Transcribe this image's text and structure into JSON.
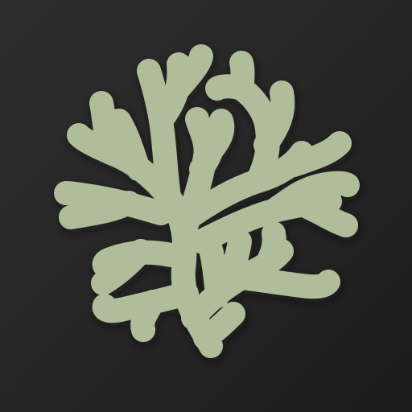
{
  "app_icon": {
    "background_color": "#262626",
    "emblem": {
      "icon": "branching-coral-icon",
      "color": "#b0bd9a",
      "shadow_color": "#0e0e0e"
    }
  }
}
